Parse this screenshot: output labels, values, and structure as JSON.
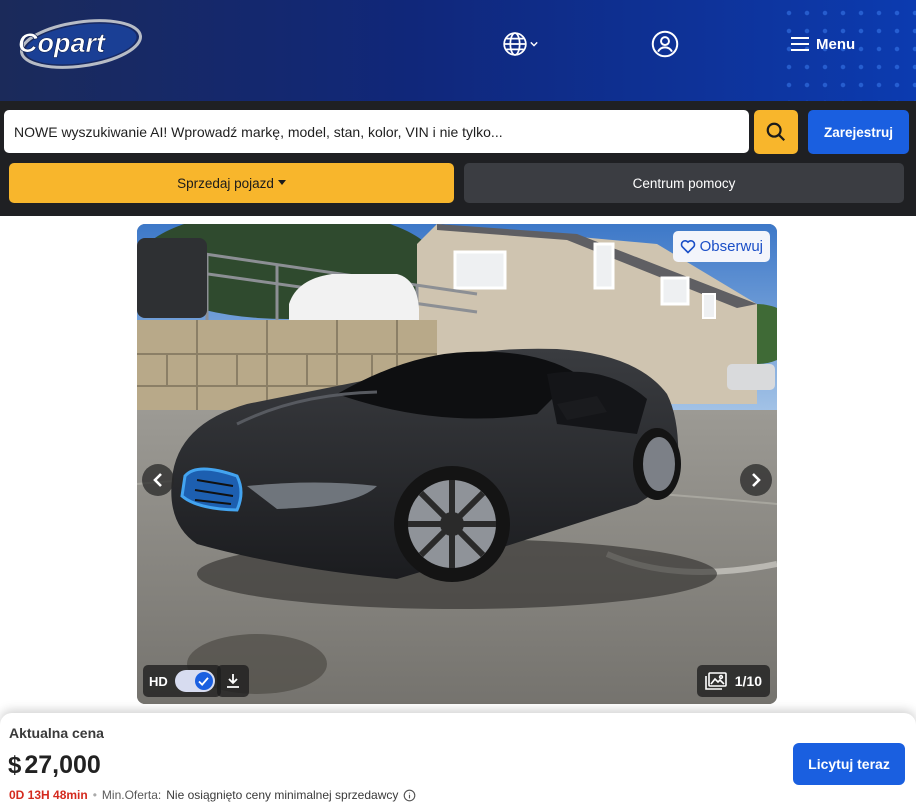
{
  "header": {
    "logo_text": "Copart",
    "menu_label": "Menu",
    "globe_icon": "globe-icon",
    "user_icon": "user-circle-icon"
  },
  "search": {
    "placeholder": "NOWE wyszukiwanie AI! Wprowadź markę, model, stan, kolor, VIN i nie tylko...",
    "value": "",
    "register_label": "Zarejestruj"
  },
  "actions": {
    "sell_label": "Sprzedaj pojazd",
    "help_label": "Centrum pomocy"
  },
  "gallery": {
    "watch_label": "Obserwuj",
    "hd_label": "HD",
    "hd_enabled": true,
    "counter": "1/10"
  },
  "price_panel": {
    "label": "Aktualna cena",
    "currency": "$",
    "amount": "27,000",
    "timer": "0D 13H 48min",
    "separator": "•",
    "min_offer_label": "Min.Oferta:",
    "min_offer_text": "Nie osiągnięto ceny minimalnej sprzedawcy",
    "bid_label": "Licytuj teraz"
  },
  "colors": {
    "brand_blue": "#1a5fe0",
    "accent_yellow": "#f8b62c",
    "timer_red": "#d42a1e",
    "dark_band": "#1f2023"
  }
}
